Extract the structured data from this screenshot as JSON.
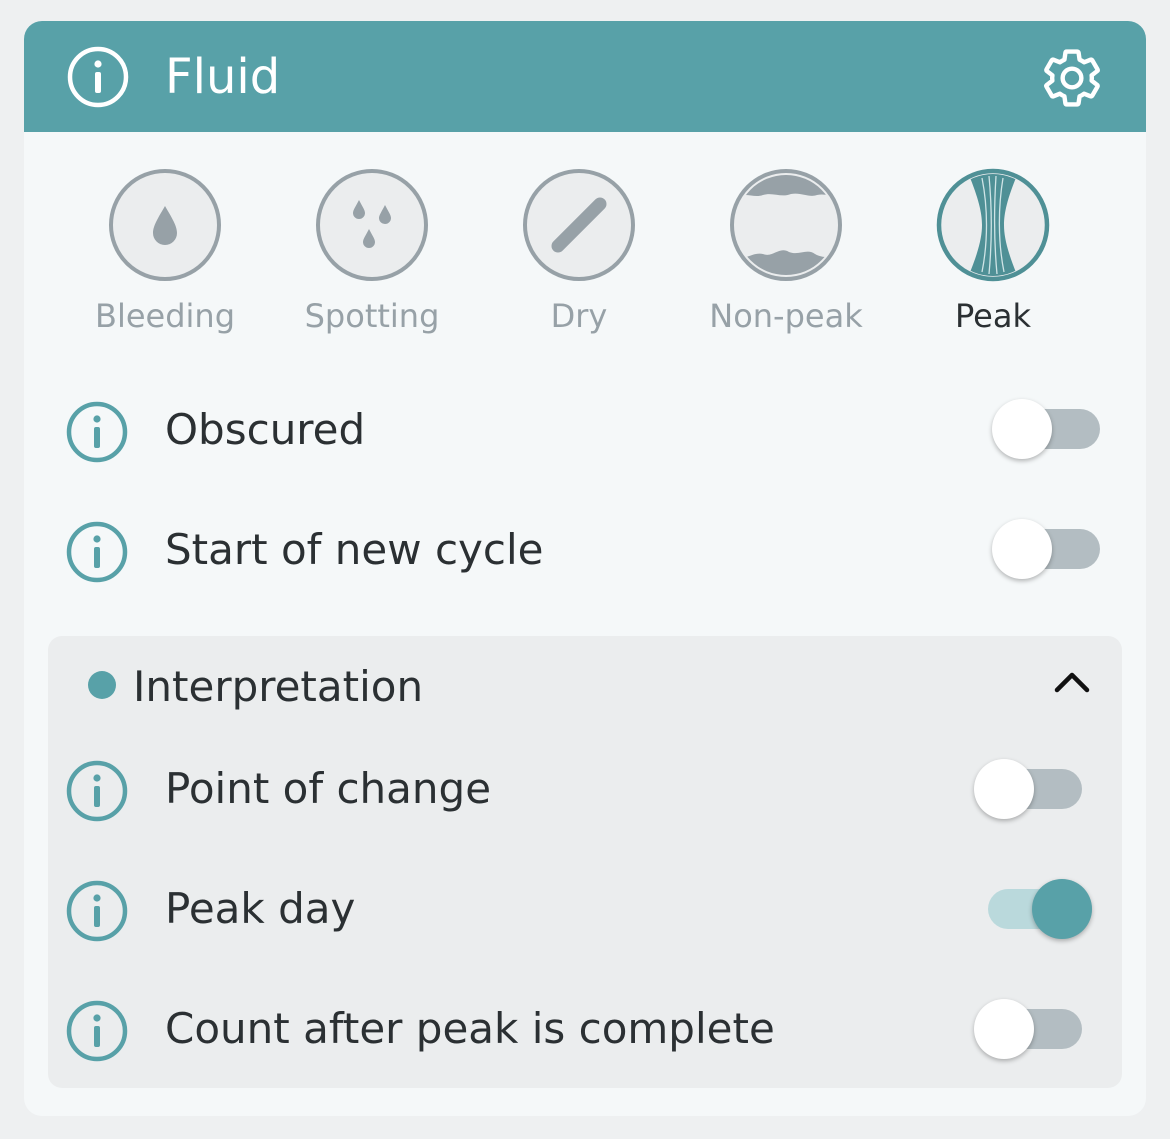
{
  "header": {
    "title": "Fluid",
    "info_icon": "info-icon",
    "settings_icon": "gear-icon"
  },
  "fluid_options": [
    {
      "label": "Bleeding",
      "icon": "drop-icon",
      "selected": false
    },
    {
      "label": "Spotting",
      "icon": "drops-icon",
      "selected": false
    },
    {
      "label": "Dry",
      "icon": "slash-icon",
      "selected": false
    },
    {
      "label": "Non-peak",
      "icon": "non-peak-icon",
      "selected": false
    },
    {
      "label": "Peak",
      "icon": "peak-icon",
      "selected": true
    }
  ],
  "toggles": [
    {
      "label": "Obscured",
      "on": false
    },
    {
      "label": "Start of new cycle",
      "on": false
    }
  ],
  "interpretation": {
    "title": "Interpretation",
    "expanded": true,
    "items": [
      {
        "label": "Point of change",
        "on": false
      },
      {
        "label": "Peak day",
        "on": true
      },
      {
        "label": "Count after peak is complete",
        "on": false
      }
    ]
  },
  "colors": {
    "accent": "#58a1a8",
    "inactive": "#97a1a7",
    "text": "#2b3033"
  }
}
